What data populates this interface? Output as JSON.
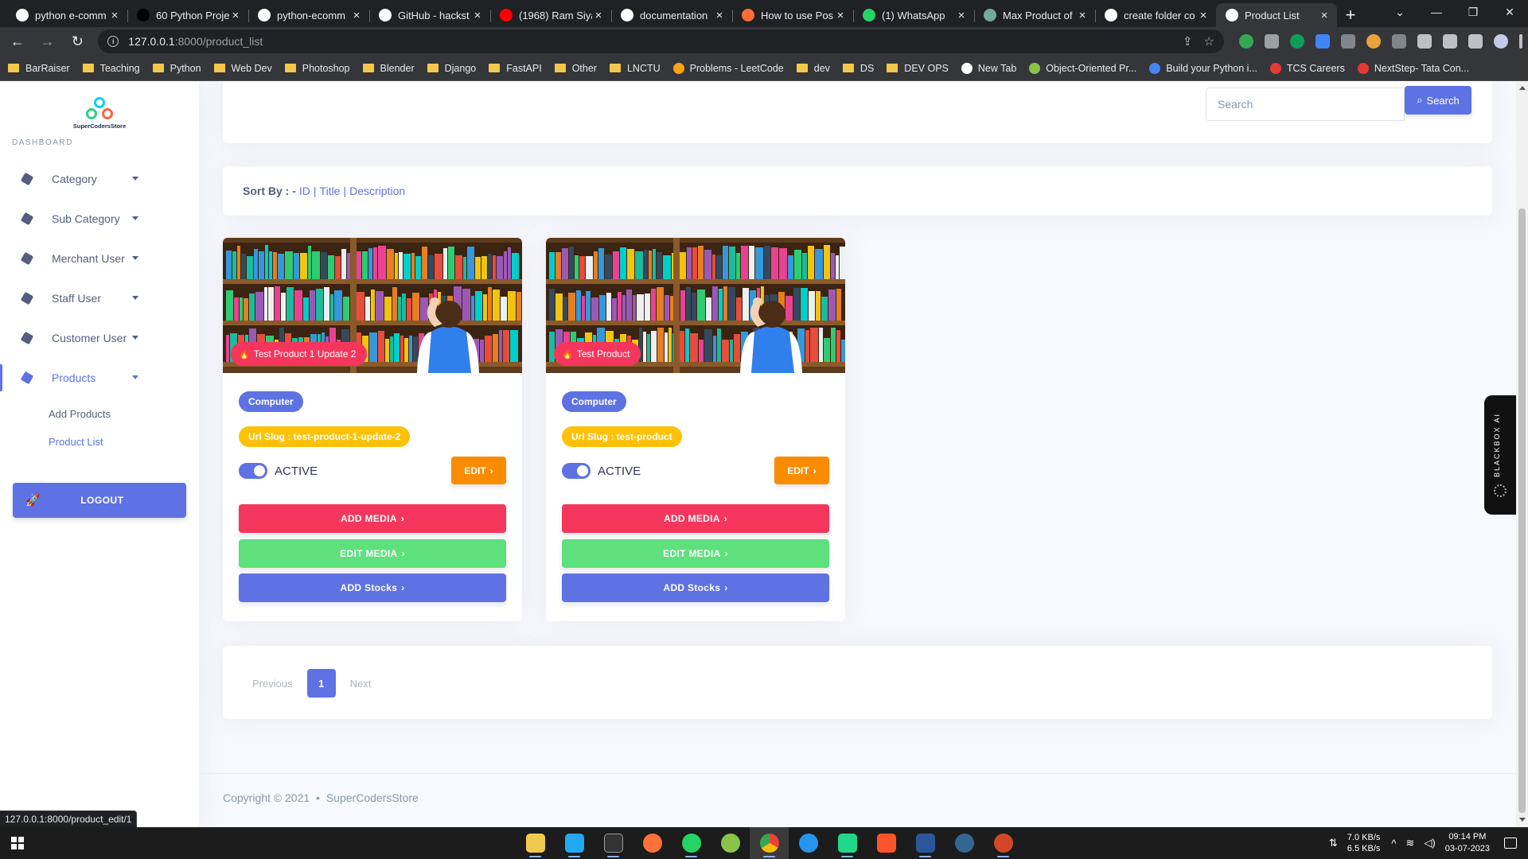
{
  "browser": {
    "tabs": [
      {
        "title": "python e-comm",
        "icon": "google-icon",
        "color": "#ffffff"
      },
      {
        "title": "60 Python Proje",
        "icon": "medium-icon",
        "color": "#000000"
      },
      {
        "title": "python-ecomm",
        "icon": "github-icon",
        "color": "#ffffff"
      },
      {
        "title": "GitHub - hackst",
        "icon": "github-icon",
        "color": "#ffffff"
      },
      {
        "title": "(1968) Ram Siya",
        "icon": "youtube-icon",
        "color": "#ff0000"
      },
      {
        "title": "documentation",
        "icon": "google-icon",
        "color": "#ffffff"
      },
      {
        "title": "How to use Pos",
        "icon": "postman-icon",
        "color": "#ff6c37"
      },
      {
        "title": "(1) WhatsApp",
        "icon": "whatsapp-icon",
        "color": "#25d366"
      },
      {
        "title": "Max Product of",
        "icon": "chatgpt-icon",
        "color": "#74aa9c"
      },
      {
        "title": "create folder co",
        "icon": "google-icon",
        "color": "#ffffff"
      },
      {
        "title": "Product List",
        "icon": "globe-icon",
        "color": "#ffffff",
        "active": true
      }
    ],
    "url_host": "127.0.0.1",
    "url_path": ":8000/product_list",
    "bookmarks": [
      {
        "label": "BarRaiser",
        "type": "folder"
      },
      {
        "label": "Teaching",
        "type": "folder"
      },
      {
        "label": "Python",
        "type": "folder"
      },
      {
        "label": "Web Dev",
        "type": "folder"
      },
      {
        "label": "Photoshop",
        "type": "folder"
      },
      {
        "label": "Blender",
        "type": "folder"
      },
      {
        "label": "Django",
        "type": "folder"
      },
      {
        "label": "FastAPI",
        "type": "folder"
      },
      {
        "label": "Other",
        "type": "folder"
      },
      {
        "label": "LNCTU",
        "type": "folder"
      },
      {
        "label": "Problems - LeetCode",
        "type": "site",
        "color": "#ffa116"
      },
      {
        "label": "dev",
        "type": "folder"
      },
      {
        "label": "DS",
        "type": "folder"
      },
      {
        "label": "DEV OPS",
        "type": "folder"
      },
      {
        "label": "New Tab",
        "type": "site",
        "color": "#ffffff"
      },
      {
        "label": "Object-Oriented Pr...",
        "type": "site",
        "color": "#8bc34a"
      },
      {
        "label": "Build your Python i...",
        "type": "site",
        "color": "#4285f4"
      },
      {
        "label": "TCS Careers",
        "type": "site",
        "color": "#e53935"
      },
      {
        "label": "NextStep- Tata Con...",
        "type": "site",
        "color": "#e53935"
      }
    ],
    "status_url": "127.0.0.1:8000/product_edit/1"
  },
  "sidebar": {
    "brand": "SuperCodersStore",
    "heading": "DASHBOARD",
    "items": [
      {
        "label": "Category"
      },
      {
        "label": "Sub Category"
      },
      {
        "label": "Merchant User"
      },
      {
        "label": "Staff User"
      },
      {
        "label": "Customer User"
      },
      {
        "label": "Products"
      }
    ],
    "sub_items": [
      {
        "label": "Add Products"
      },
      {
        "label": "Product List"
      }
    ],
    "logout": "LOGOUT"
  },
  "search": {
    "placeholder": "Search",
    "button": "Search"
  },
  "sort": {
    "label": "Sort By : -",
    "options": [
      "ID",
      "Title",
      "Description"
    ]
  },
  "products": [
    {
      "title": "Test Product 1 Update 2",
      "category": "Computer",
      "slug": "Url Slug : test-product-1-update-2",
      "status": "ACTIVE",
      "edit": "EDIT",
      "add_media": "ADD MEDIA",
      "edit_media": "EDIT MEDIA",
      "add_stocks": "ADD Stocks"
    },
    {
      "title": "Test Product",
      "category": "Computer",
      "slug": "Url Slug : test-product",
      "status": "ACTIVE",
      "edit": "EDIT",
      "add_media": "ADD MEDIA",
      "edit_media": "EDIT MEDIA",
      "add_stocks": "ADD Stocks"
    }
  ],
  "pagination": {
    "previous": "Previous",
    "current": "1",
    "next": "Next"
  },
  "footer": {
    "copyright": "Copyright © 2021",
    "bullet": "•",
    "brand": "SuperCodersStore"
  },
  "blackbox": {
    "label": "BLACKBOX AI"
  },
  "taskbar": {
    "net_down": "7.0 KB/s",
    "net_up": "6.5 KB/s",
    "time": "09:14 PM",
    "date": "03-07-2023"
  },
  "colors": {
    "primary": "#5e72e4",
    "danger": "#f5365c",
    "warning": "#ffc107",
    "orange": "#fb8c00",
    "success": "#5ee07c"
  }
}
